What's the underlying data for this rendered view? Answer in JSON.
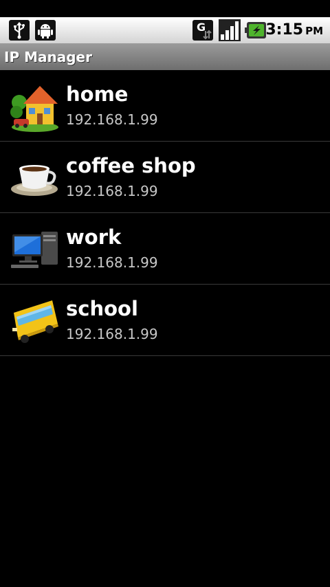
{
  "statusbar": {
    "time": "3:15",
    "ampm": "PM",
    "icons": [
      "usb-icon",
      "android-debug-icon",
      "gprs-data-icon",
      "signal-icon",
      "battery-charging-icon"
    ],
    "network_letter": "G"
  },
  "app": {
    "title": "IP Manager"
  },
  "locations": [
    {
      "name": "home",
      "ip": "192.168.1.99",
      "icon": "house-icon"
    },
    {
      "name": "coffee shop",
      "ip": "192.168.1.99",
      "icon": "coffee-cup-icon"
    },
    {
      "name": "work",
      "ip": "192.168.1.99",
      "icon": "computer-icon"
    },
    {
      "name": "school",
      "ip": "192.168.1.99",
      "icon": "school-bus-icon"
    }
  ],
  "colors": {
    "background": "#000000",
    "titlebar": "#8a8a8a",
    "battery": "#4fb42d"
  }
}
